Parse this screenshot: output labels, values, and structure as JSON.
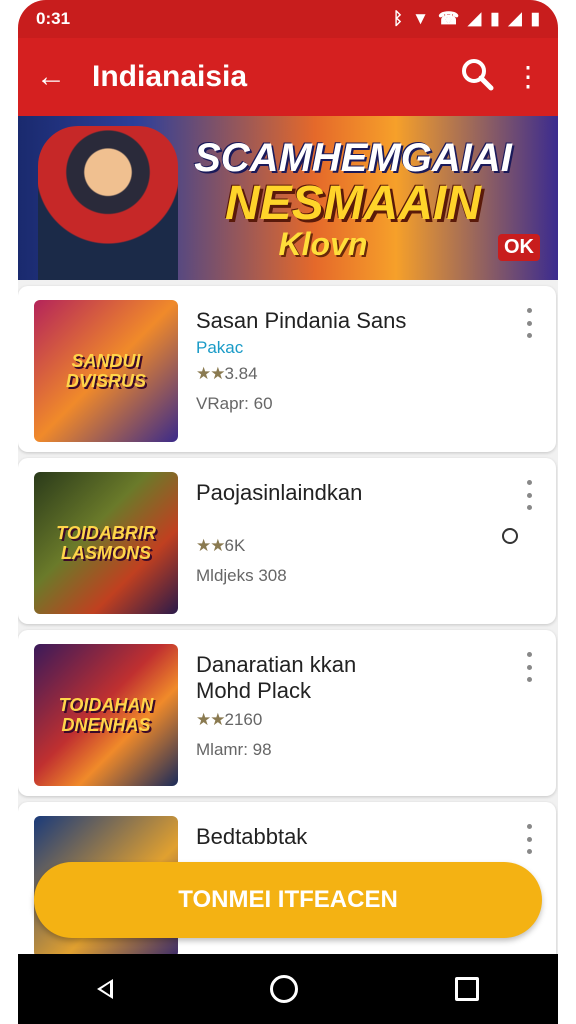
{
  "status_bar": {
    "time": "0:31"
  },
  "app_bar": {
    "title": "Indianaisia"
  },
  "banner": {
    "line1": "SCAMHEMGAIAI",
    "line2": "NESMAAIN",
    "line3": "Klovn",
    "badge": "OK"
  },
  "games": [
    {
      "name": "Sasan Pindania Sans",
      "sub": "Pakac",
      "rating": "3.84",
      "meta": "VRapr: 60",
      "thumb_label": "SANDUI DVISRUS"
    },
    {
      "name": "Paojasinlaindkan",
      "sub": "",
      "rating": "6K",
      "meta": "Mldjeks 308",
      "thumb_label": "TOIDABRIR LASMONS"
    },
    {
      "name": "Danaratian kkan",
      "sub2": "Mohd Plack",
      "rating": "2160",
      "meta": "Mlamr: 98",
      "thumb_label": "TOIDAHAN DNENHAS"
    },
    {
      "name": "Bedtabbtak",
      "sub": "",
      "rating": "",
      "meta": "",
      "thumb_label": ""
    }
  ],
  "fab": {
    "label": "TONMEI ITFEACEN"
  },
  "colors": {
    "primary": "#d52020",
    "accent": "#f4b213",
    "link": "#1a9bc7"
  }
}
